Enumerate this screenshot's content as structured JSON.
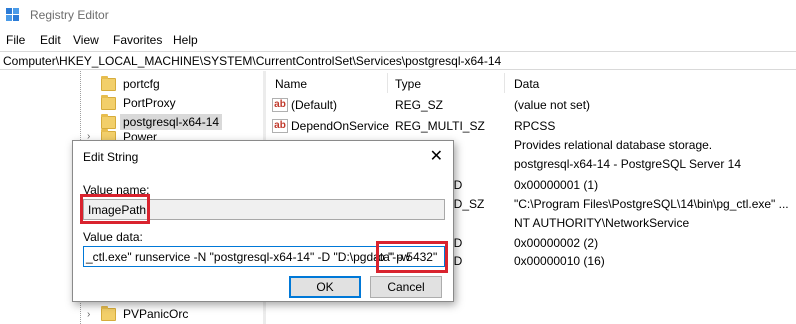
{
  "window": {
    "title": "Registry Editor",
    "icon": "registry-icon",
    "accent": "#0078d7"
  },
  "menu": [
    "File",
    "Edit",
    "View",
    "Favorites",
    "Help"
  ],
  "address": "Computer\\HKEY_LOCAL_MACHINE\\SYSTEM\\CurrentControlSet\\Services\\postgresql-x64-14",
  "tree": {
    "items": [
      {
        "label": "portcfg"
      },
      {
        "label": "PortProxy"
      },
      {
        "label": "postgresql-x64-14",
        "selected": true
      },
      {
        "label": "Power"
      },
      {
        "label": "PVPanicOrc"
      }
    ]
  },
  "list": {
    "headers": {
      "name": "Name",
      "type": "Type",
      "data": "Data"
    },
    "rows": [
      {
        "name": "(Default)",
        "type": "REG_SZ",
        "data": "(value not set)"
      },
      {
        "name": "DependOnService",
        "type": "REG_MULTI_SZ",
        "data": "RPCSS"
      },
      {
        "name": "",
        "type": "",
        "data": "Provides relational database storage."
      },
      {
        "name": "",
        "type": "",
        "data": "postgresql-x64-14 - PostgreSQL Server 14"
      },
      {
        "name": "",
        "type": "RD",
        "data": "0x00000001 (1)"
      },
      {
        "name": "",
        "type": "ND_SZ",
        "data": "\"C:\\Program Files\\PostgreSQL\\14\\bin\\pg_ctl.exe\" ..."
      },
      {
        "name": "",
        "type": "",
        "data": "NT AUTHORITY\\NetworkService"
      },
      {
        "name": "",
        "type": "RD",
        "data": "0x00000002 (2)"
      },
      {
        "name": "",
        "type": "RD",
        "data": "0x00000010 (16)"
      }
    ]
  },
  "dialog": {
    "title": "Edit String",
    "value_name_label": "Value name:",
    "value_name": "ImagePath",
    "value_data_label": "Value data:",
    "value_data_main": "_ctl.exe\" runservice -N \"postgresql-x64-14\" -D \"D:\\pgdata\" -w",
    "value_data_tail": "-o \"-p 5432\"",
    "ok": "OK",
    "cancel": "Cancel",
    "highlight_color": "#d9232e"
  }
}
